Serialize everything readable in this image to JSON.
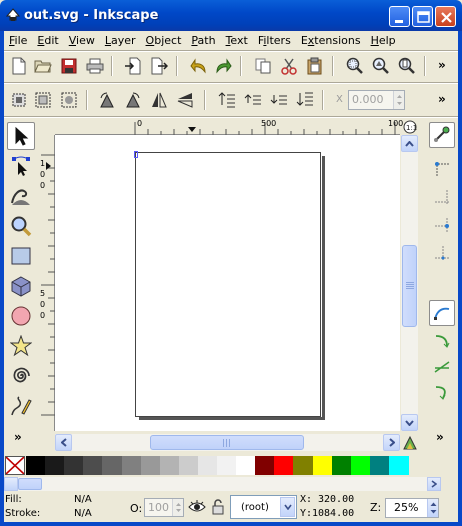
{
  "window": {
    "title": "out.svg - Inkscape",
    "controls": [
      "minimize",
      "maximize",
      "close"
    ]
  },
  "menu": {
    "items": [
      {
        "label": "File",
        "key": "F"
      },
      {
        "label": "Edit",
        "key": "E"
      },
      {
        "label": "View",
        "key": "V"
      },
      {
        "label": "Layer",
        "key": "L"
      },
      {
        "label": "Object",
        "key": "O"
      },
      {
        "label": "Path",
        "key": "P"
      },
      {
        "label": "Text",
        "key": "T"
      },
      {
        "label": "Filters",
        "key": "i"
      },
      {
        "label": "Extensions",
        "key": "x"
      },
      {
        "label": "Help",
        "key": "H"
      }
    ]
  },
  "commands_bar": {
    "icons": [
      "new-document-icon",
      "open-icon",
      "save-icon",
      "print-icon",
      "import-icon",
      "export-icon",
      "undo-icon",
      "redo-icon",
      "copy-icon",
      "cut-icon",
      "paste-icon",
      "zoom-selection-icon",
      "zoom-drawing-icon",
      "zoom-page-icon"
    ],
    "overflow": "»"
  },
  "controls_bar": {
    "icons": [
      "select-all-icon",
      "select-all-layers-icon",
      "deselect-icon",
      "rotate-ccw-icon",
      "rotate-cw-icon",
      "flip-horizontal-icon",
      "flip-vertical-icon",
      "raise-top-icon",
      "raise-icon",
      "lower-icon",
      "lower-bottom-icon"
    ],
    "x_label": "X",
    "x_value": "0.000",
    "overflow": "»"
  },
  "rulers": {
    "top": [
      "0",
      "500",
      "100"
    ],
    "left": [
      "1",
      "0",
      "0",
      "5",
      "0",
      "0"
    ]
  },
  "toolbox": {
    "tools": [
      "selector-tool-icon",
      "node-tool-icon",
      "tweak-tool-icon",
      "zoom-tool-icon",
      "rectangle-tool-icon",
      "3d-box-tool-icon",
      "ellipse-tool-icon",
      "star-tool-icon",
      "spiral-tool-icon",
      "pencil-tool-icon"
    ],
    "active": "selector-tool-icon"
  },
  "snapbar": {
    "icons": [
      "snap-enable-icon",
      "snap-bbox-icon",
      "snap-bbox-edge-icon",
      "snap-bbox-corner-icon",
      "snap-bbox-midpoint-icon",
      "snap-nodes-icon",
      "snap-paths-icon",
      "snap-intersection-icon",
      "snap-smooth-icon"
    ],
    "overflow": "»"
  },
  "palette": {
    "colors": [
      "#000000",
      "#1a1a1a",
      "#333333",
      "#4d4d4d",
      "#666666",
      "#808080",
      "#999999",
      "#b3b3b3",
      "#cccccc",
      "#e6e6e6",
      "#f2f2f2",
      "#ffffff",
      "#800000",
      "#ff0000",
      "#808000",
      "#ffff00",
      "#008000",
      "#00ff00",
      "#008080",
      "#00ffff"
    ]
  },
  "status": {
    "fill_label": "Fill:",
    "fill_value": "N/A",
    "stroke_label": "Stroke:",
    "stroke_value": "N/A",
    "opacity_label": "O:",
    "opacity_value": "100",
    "layer": "(root)",
    "x_label": "X:",
    "x_value": "320.00",
    "y_label": "Y:",
    "y_value": "1084.00",
    "zoom_label": "Z:",
    "zoom_value": "25%"
  }
}
